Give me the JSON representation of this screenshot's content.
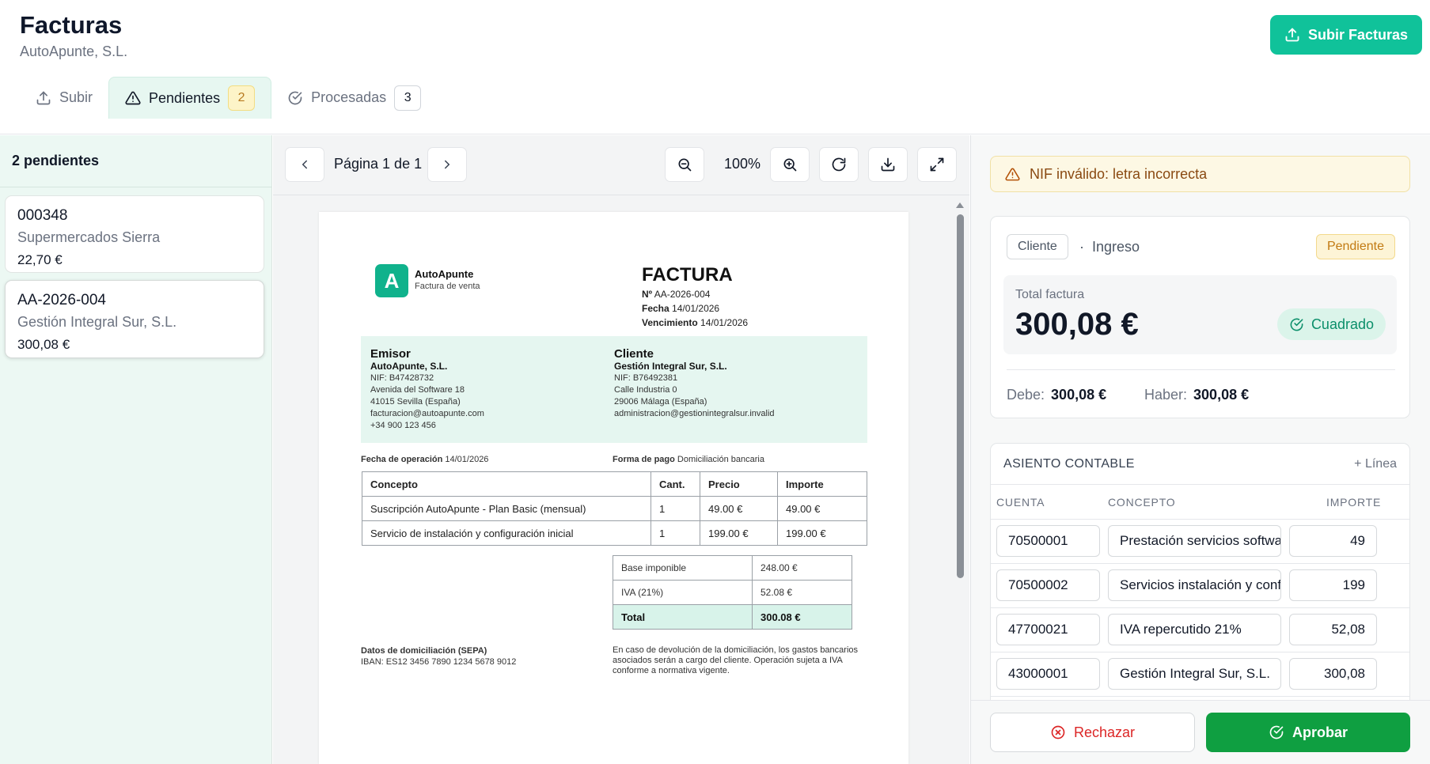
{
  "header": {
    "title": "Facturas",
    "company": "AutoApunte, S.L.",
    "upload_button": "Subir Facturas"
  },
  "tabs": [
    {
      "label": "Subir",
      "icon": "upload-icon"
    },
    {
      "label": "Pendientes",
      "count": "2",
      "icon": "warning-icon"
    },
    {
      "label": "Procesadas",
      "count": "3",
      "icon": "check-circle-icon"
    }
  ],
  "list": {
    "header": "2 pendientes",
    "items": [
      {
        "number": "000348",
        "client": "Supermercados Sierra",
        "amount": "22,70 €"
      },
      {
        "number": "AA-2026-004",
        "client": "Gestión Integral Sur, S.L.",
        "amount": "300,08 €"
      }
    ]
  },
  "viewer": {
    "page_label": "Página 1 de 1",
    "zoom": "100%"
  },
  "invoice": {
    "brand": "AutoApunte",
    "brand_sub": "Factura de venta",
    "logo_letter": "A",
    "title": "FACTURA",
    "number_label": "Nº",
    "number": "AA-2026-004",
    "date_label": "Fecha",
    "date": "14/01/2026",
    "due_label": "Vencimiento",
    "due": "14/01/2026",
    "emisor": {
      "heading": "Emisor",
      "name": "AutoApunte, S.L.",
      "nif": "NIF: B47428732",
      "address": "Avenida del Software 18",
      "city": "41015 Sevilla (España)",
      "email": "facturacion@autoapunte.com",
      "phone": "+34 900 123 456"
    },
    "cliente": {
      "heading": "Cliente",
      "name": "Gestión Integral Sur, S.L.",
      "nif": "NIF: B76492381",
      "address": "Calle Industria 0",
      "city": "29006 Málaga (España)",
      "email": "administracion@gestionintegralsur.invalid"
    },
    "op_date_label": "Fecha de operación",
    "op_date": "14/01/2026",
    "payment_label": "Forma de pago",
    "payment": "Domiciliación bancaria",
    "columns": [
      "Concepto",
      "Cant.",
      "Precio",
      "Importe"
    ],
    "lines": [
      {
        "concept": "Suscripción AutoApunte - Plan Basic (mensual)",
        "qty": "1",
        "price": "49.00 €",
        "amount": "49.00 €"
      },
      {
        "concept": "Servicio de instalación y configuración inicial",
        "qty": "1",
        "price": "199.00 €",
        "amount": "199.00 €"
      }
    ],
    "totals": {
      "base_label": "Base imponible",
      "base": "248.00 €",
      "iva_label": "IVA (21%)",
      "iva": "52.08 €",
      "total_label": "Total",
      "total": "300.08 €"
    },
    "sepa_title": "Datos de domiciliación (SEPA)",
    "iban": "IBAN: ES12 3456 7890 1234 5678 9012",
    "notice": "En caso de devolución de la domiciliación, los gastos bancarios asociados serán a cargo del cliente. Operación sujeta a IVA conforme a normativa vigente."
  },
  "panel": {
    "alert": "NIF inválido: letra incorrecta",
    "type_pill": "Cliente",
    "type_separator": "·",
    "type": "Ingreso",
    "status": "Pendiente",
    "total_label": "Total factura",
    "total": "300,08 €",
    "balanced": "Cuadrado",
    "debe_label": "Debe:",
    "debe": "300,08 €",
    "haber_label": "Haber:",
    "haber": "300,08 €",
    "entry_title": "ASIENTO CONTABLE",
    "add_line": "+ Línea",
    "columns": {
      "account": "CUENTA",
      "concept": "CONCEPTO",
      "amount": "IMPORTE"
    },
    "rows": [
      {
        "account": "70500001",
        "concept": "Prestación servicios software",
        "amount": "49"
      },
      {
        "account": "70500002",
        "concept": "Servicios instalación y configuración",
        "amount": "199"
      },
      {
        "account": "47700021",
        "concept": "IVA repercutido 21%",
        "amount": "52,08"
      },
      {
        "account": "43000001",
        "concept": "Gestión Integral Sur, S.L.",
        "amount": "300,08"
      }
    ],
    "reject": "Rechazar",
    "approve": "Aprobar"
  },
  "colors": {
    "accent": "#10c29a",
    "approve": "#0f9f41",
    "reject": "#dc2626",
    "pending": "#c27a12"
  }
}
